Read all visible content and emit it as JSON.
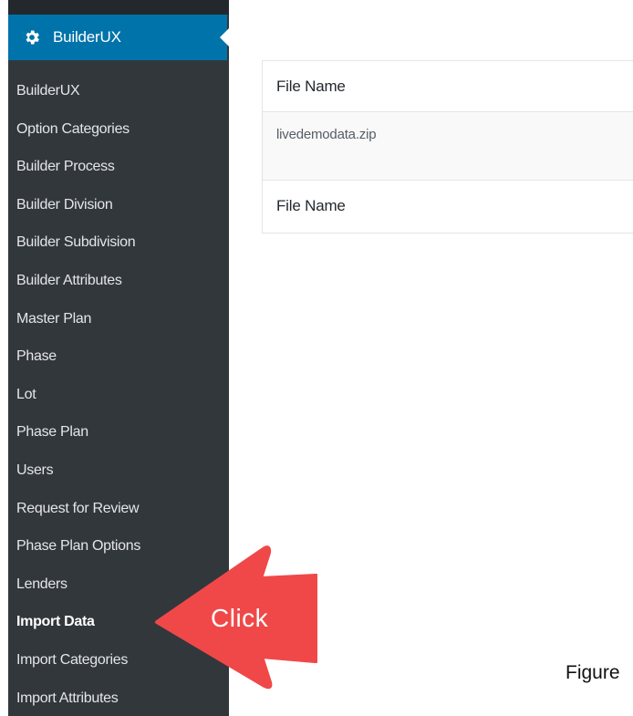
{
  "sidebar": {
    "header_label": "BuilderUX",
    "items": [
      {
        "label": "BuilderUX"
      },
      {
        "label": "Option Categories"
      },
      {
        "label": "Builder Process"
      },
      {
        "label": "Builder Division"
      },
      {
        "label": "Builder Subdivision"
      },
      {
        "label": "Builder Attributes"
      },
      {
        "label": "Master Plan"
      },
      {
        "label": "Phase"
      },
      {
        "label": "Lot"
      },
      {
        "label": "Phase Plan"
      },
      {
        "label": "Users"
      },
      {
        "label": "Request for Review"
      },
      {
        "label": "Phase Plan Options"
      },
      {
        "label": "Lenders"
      },
      {
        "label": "Import Data"
      },
      {
        "label": "Import Categories"
      },
      {
        "label": "Import Attributes"
      }
    ]
  },
  "table": {
    "header": "File Name",
    "file": "livedemodata.zip",
    "footer": "File Name"
  },
  "annotation": {
    "label": "Click",
    "color": "#f04848"
  },
  "caption": "Figure",
  "colors": {
    "sidebar_bg": "#32373c",
    "header_bg": "#0073aa"
  }
}
